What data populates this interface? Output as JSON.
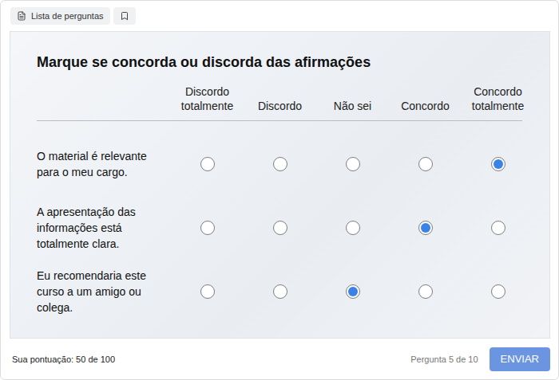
{
  "toolbar": {
    "question_list_button": "Lista de perguntas"
  },
  "survey": {
    "title": "Marque se concorda ou discorda das afirmações",
    "columns": [
      "Discordo totalmente",
      "Discordo",
      "Não sei",
      "Concordo",
      "Concordo totalmente"
    ],
    "rows": [
      {
        "statement": "O material é relevante para o meu cargo.",
        "options": [
          {
            "selected": false
          },
          {
            "selected": false
          },
          {
            "selected": false
          },
          {
            "selected": false
          },
          {
            "selected": true
          }
        ]
      },
      {
        "statement": "A apresentação das informações está totalmente clara.",
        "options": [
          {
            "selected": false
          },
          {
            "selected": false
          },
          {
            "selected": false
          },
          {
            "selected": true
          },
          {
            "selected": false
          }
        ]
      },
      {
        "statement": "Eu recomendaria este curso a um amigo ou colega.",
        "options": [
          {
            "selected": false
          },
          {
            "selected": false
          },
          {
            "selected": true
          },
          {
            "selected": false
          },
          {
            "selected": false
          }
        ]
      }
    ]
  },
  "footer": {
    "score": "Sua pontuação: 50 de 100",
    "progress": "Pergunta 5 de 10",
    "submit_button": "ENVIAR"
  }
}
